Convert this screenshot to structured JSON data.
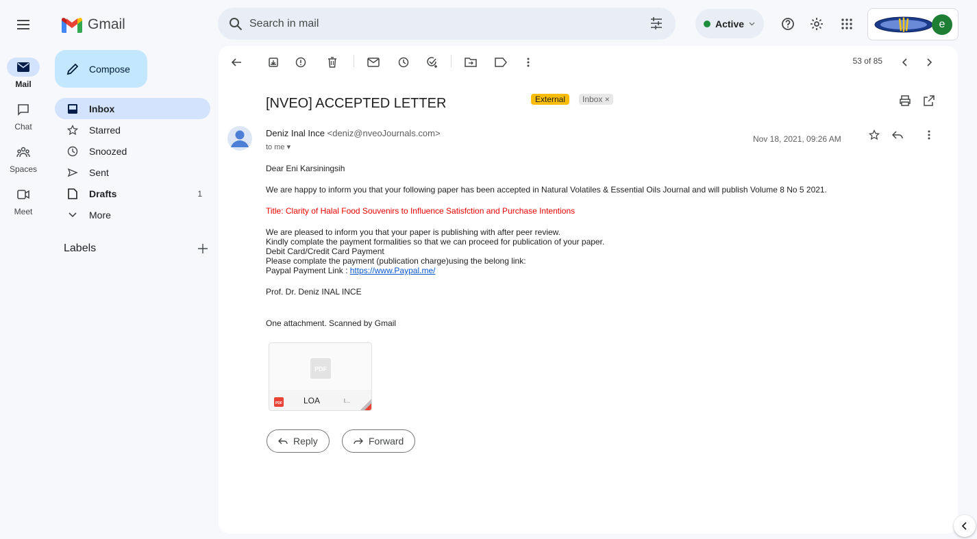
{
  "app": {
    "name": "Gmail"
  },
  "rail": [
    {
      "label": "Mail",
      "icon": "mail-icon",
      "active": true
    },
    {
      "label": "Chat",
      "icon": "chat-icon"
    },
    {
      "label": "Spaces",
      "icon": "spaces-icon"
    },
    {
      "label": "Meet",
      "icon": "meet-icon"
    }
  ],
  "compose": {
    "label": "Compose"
  },
  "nav": [
    {
      "label": "Inbox",
      "icon": "inbox-icon",
      "count": ""
    },
    {
      "label": "Starred",
      "icon": "star-icon",
      "count": ""
    },
    {
      "label": "Snoozed",
      "icon": "clock-icon",
      "count": ""
    },
    {
      "label": "Sent",
      "icon": "send-icon",
      "count": ""
    },
    {
      "label": "Drafts",
      "icon": "draft-icon",
      "count": "1"
    },
    {
      "label": "More",
      "icon": "chevron-down-icon",
      "count": ""
    }
  ],
  "labels": {
    "title": "Labels"
  },
  "search": {
    "placeholder": "Search in mail"
  },
  "status": {
    "label": "Active",
    "color": "#1e8e3e"
  },
  "account": {
    "initial": "e",
    "color": "#1e7e34"
  },
  "toolbar": {
    "pager": "53 of 85"
  },
  "email": {
    "subject": "[NVEO] ACCEPTED LETTER",
    "badges": {
      "external": "External",
      "inbox": "Inbox ×"
    },
    "sender_name": "Deniz Inal Ince",
    "sender_email": "<deniz@nveoJournals.com>",
    "to": "to me",
    "date": "Nov 18, 2021, 09:26 AM",
    "greeting": "Dear Eni Karsiningsih",
    "para1": "We are happy to inform you that your following paper has been accepted in Natural Volatiles & Essential Oils Journal and will publish Volume 8 No 5 2021.",
    "title_line": "Title: Clarity of Halal Food Souvenirs to Influence Satisfction and Purchase Intentions",
    "lines": [
      "We are pleased to inform you that your paper is publishing with after peer review.",
      "Kindly complate the payment formalities so that we can proceed for publication of your paper.",
      "Debit Card/Credit Card Payment",
      "Please complate the payment (publication charge)using the belong link:"
    ],
    "paypal_label": "Paypal Payment Link : ",
    "paypal_link": "https://www.Paypal.me/",
    "signature": "Prof. Dr. Deniz INAL INCE",
    "attachment_note": "One attachment. Scanned by Gmail",
    "attachment_name": "LOA",
    "attachment_trunc": "l..."
  },
  "actions": {
    "reply": "Reply",
    "forward": "Forward"
  }
}
